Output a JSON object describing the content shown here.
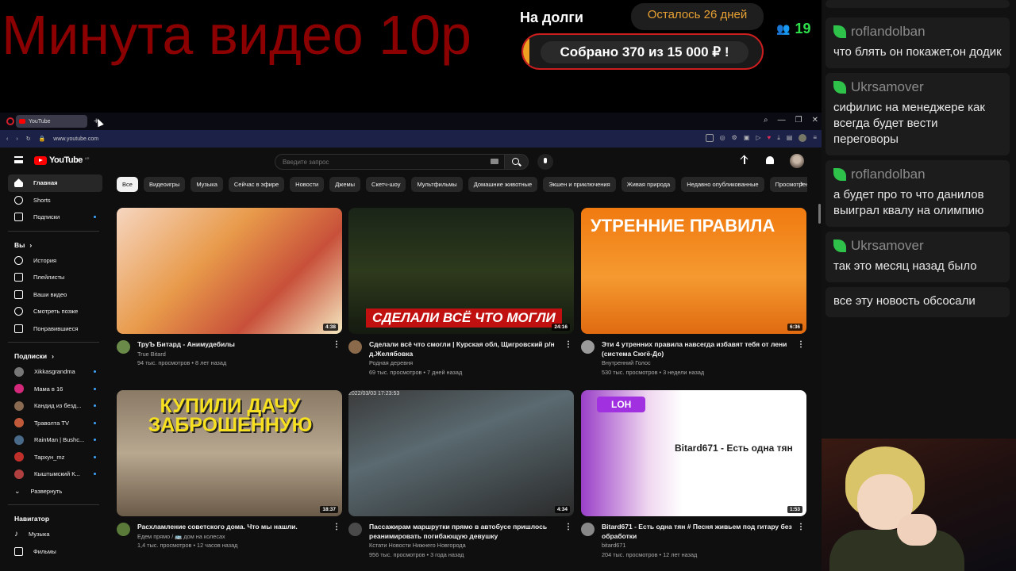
{
  "overlay": {
    "big_title": "Минута видео 10р",
    "debt_label": "На долги",
    "days_left": "Осталось 26 дней",
    "collected": "Собрано 370  из 15 000 ₽ !",
    "collected_progress": 0.025,
    "viewers": "19"
  },
  "chat": {
    "messages": [
      {
        "user": "roflandolban",
        "text": "что блять он покажет,он додик"
      },
      {
        "user": "Ukrsamover",
        "text": "сифилис на менеджере как всегда будет вести переговоры"
      },
      {
        "user": "roflandolban",
        "text": "а будет про то что данилов выиграл квалу на олимпию"
      },
      {
        "user": "Ukrsamover",
        "text": "так это месяц назад было"
      },
      {
        "user": "",
        "text": "все эту новость обсосали"
      }
    ]
  },
  "browser": {
    "tab_title": "YouTube",
    "url": "www.youtube.com"
  },
  "youtube": {
    "logo": "YouTube",
    "logo_sup": "AR",
    "search_placeholder": "Введите запрос",
    "sidebar": {
      "main": [
        {
          "label": "Главная",
          "icon": "home-icon"
        },
        {
          "label": "Shorts",
          "icon": "shorts-icon"
        },
        {
          "label": "Подписки",
          "icon": "subscriptions-icon"
        }
      ],
      "you_header": "Вы",
      "you": [
        {
          "label": "История",
          "icon": "history-icon"
        },
        {
          "label": "Плейлисты",
          "icon": "playlist-icon"
        },
        {
          "label": "Ваши видео",
          "icon": "your-videos-icon"
        },
        {
          "label": "Смотреть позже",
          "icon": "clock-icon"
        },
        {
          "label": "Понравившиеся",
          "icon": "thumbs-up-icon"
        }
      ],
      "subs_header": "Подписки",
      "subs": [
        {
          "label": "Xikkasgrandma",
          "color": "#777777"
        },
        {
          "label": "Мама в 16",
          "color": "#d4287a"
        },
        {
          "label": "Кандид из безд...",
          "color": "#8a6a50"
        },
        {
          "label": "Траволта TV",
          "color": "#c05a3a"
        },
        {
          "label": "RainMan | Bushc...",
          "color": "#4a6a8a"
        },
        {
          "label": "Тархун_mz",
          "color": "#c0302a"
        },
        {
          "label": "Кыштымский К...",
          "color": "#b04040"
        }
      ],
      "expand": "Развернуть",
      "nav_header": "Навигатор",
      "nav": [
        {
          "label": "Музыка",
          "icon": "music-icon"
        },
        {
          "label": "Фильмы",
          "icon": "film-icon"
        }
      ]
    },
    "chips": [
      "Все",
      "Видеоигры",
      "Музыка",
      "Сейчас в эфире",
      "Новости",
      "Джемы",
      "Скетч-шоу",
      "Мультфильмы",
      "Домашние животные",
      "Экшен и приключения",
      "Живая природа",
      "Недавно опубликованные",
      "Просмотрено"
    ],
    "videos": [
      {
        "title": "ТруЪ Битард - Анимудебилы",
        "channel": "True Bitard",
        "stats": "94 тыс. просмотров • 8 лет назад",
        "duration": "4:38",
        "thumb_text": ""
      },
      {
        "title": "Сделали всё что смогли | Курская обл, Щигровский р/н д.Желябовка",
        "channel": "Родная деревня",
        "stats": "69 тыс. просмотров • 7 дней назад",
        "duration": "24:16",
        "thumb_text": "СДЕЛАЛИ ВСЁ ЧТО МОГЛИ"
      },
      {
        "title": "Эти 4 утренних правила навсегда избавят тебя от лени (система Сюгё-До)",
        "channel": "Внутренний Голос",
        "stats": "530 тыс. просмотров • 3 недели назад",
        "duration": "6:36",
        "thumb_text": "УТРЕННИЕ ПРАВИЛА"
      },
      {
        "title": "Расхламление советского дома. Что мы нашли.",
        "channel": "Едем прямо / 🚌 дом на колесах",
        "stats": "1,4 тыс. просмотров • 12 часов назад",
        "duration": "18:37",
        "thumb_text": "КУПИЛИ ДАЧУ ЗАБРОШЕННУЮ"
      },
      {
        "title": "Пассажирам маршрутки прямо в автобусе пришлось реанимировать погибающую девушку",
        "channel": "Кстати Новости Нижнего Новгорода",
        "stats": "956 тыс. просмотров • 3 года назад",
        "duration": "4:34",
        "thumb_text": "2022/03/03 17:23:53"
      },
      {
        "title": "Bitard671 - Есть одна тян # Песня живьем под гитару без обработки",
        "channel": "bitard671",
        "stats": "204 тыс. просмотров • 12 лет назад",
        "duration": "1:53",
        "thumb_text": "Bitard671 - Есть одна тян",
        "thumb_badge": "LOH"
      }
    ]
  }
}
